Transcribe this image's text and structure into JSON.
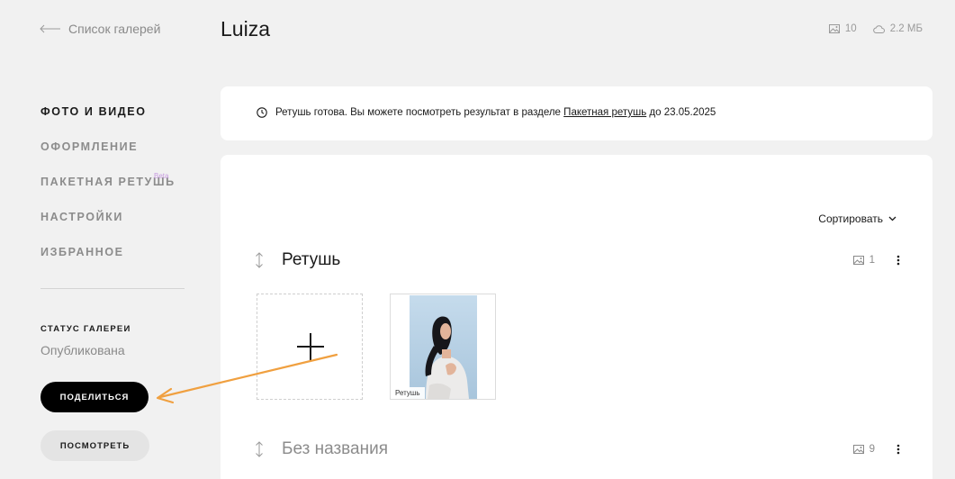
{
  "sidebar": {
    "back_label": "Список галерей",
    "nav": [
      {
        "label": "ФОТО И ВИДЕО",
        "active": true
      },
      {
        "label": "ОФОРМЛЕНИЕ"
      },
      {
        "label": "ПАКЕТНАЯ РЕТУШЬ",
        "badge": "Beta"
      },
      {
        "label": "НАСТРОЙКИ"
      },
      {
        "label": "ИЗБРАННОЕ"
      }
    ],
    "status_label": "СТАТУС ГАЛЕРЕИ",
    "status_value": "Опубликована",
    "share_label": "ПОДЕЛИТЬСЯ",
    "view_label": "ПОСМОТРЕТЬ"
  },
  "header": {
    "title": "Luiza",
    "photo_count": "10",
    "size": "2.2 МБ"
  },
  "notice": {
    "text_before": "Ретушь готова. Вы можете посмотреть результат в разделе",
    "link": "Пакетная ретушь",
    "text_after": "до 23.05.2025"
  },
  "main": {
    "sort_label": "Сортировать",
    "sections": [
      {
        "title": "Ретушь",
        "count": "1",
        "photo_tag": "Ретушь"
      },
      {
        "title": "Без названия",
        "count": "9"
      }
    ]
  },
  "colors": {
    "background": "#f1f1f1",
    "card": "#ffffff",
    "primary_button": "#000000",
    "annotation_arrow": "#f0a040",
    "beta_badge": "#c79be0"
  },
  "icons": [
    "arrow-left-icon",
    "image-icon",
    "cloud-icon",
    "clock-icon",
    "chevron-down-icon",
    "drag-handle-icon",
    "kebab-menu-icon",
    "plus-icon"
  ]
}
